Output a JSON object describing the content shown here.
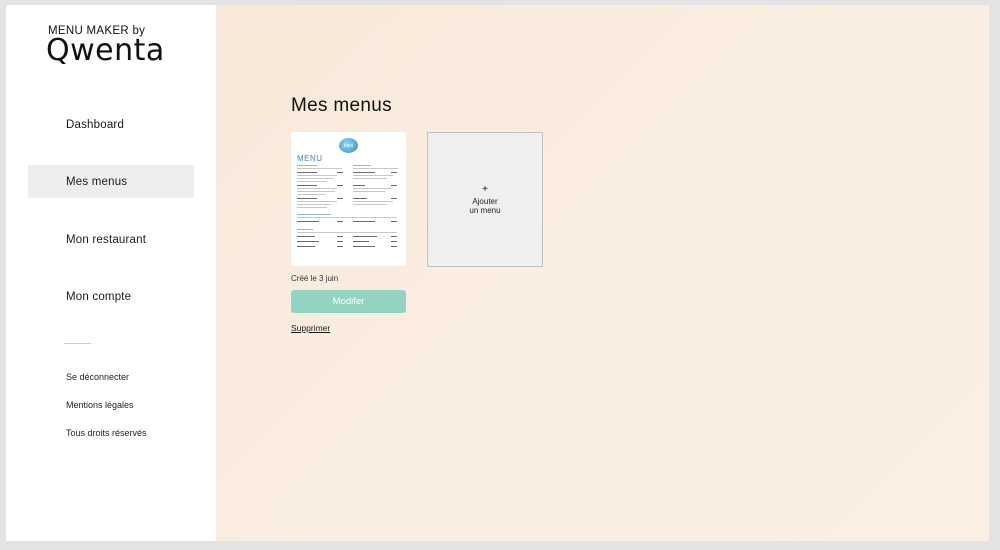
{
  "brand": {
    "top": "MENU MAKER by",
    "logo": "Qwenta"
  },
  "sidebar": {
    "items": [
      {
        "label": "Dashboard"
      },
      {
        "label": "Mes menus",
        "active": true
      },
      {
        "label": "Mon restaurant"
      },
      {
        "label": "Mon compte"
      }
    ],
    "footer": [
      {
        "label": "Se déconnecter"
      },
      {
        "label": "Mentions légales"
      },
      {
        "label": "Tous droits réservés"
      }
    ]
  },
  "main": {
    "title": "Mes menus",
    "menu_card": {
      "logo_text": "kasi",
      "preview_title": "MENU",
      "created": "Créé le 3 juin",
      "modify_label": "Modifer",
      "delete_label": "Supprimer"
    },
    "add_card": {
      "plus": "+",
      "line1": "Ajouter",
      "line2": "un menu"
    }
  },
  "colors": {
    "accent": "#93d3c1",
    "active_bg": "#ededed",
    "menu_blue": "#3b87c7"
  }
}
